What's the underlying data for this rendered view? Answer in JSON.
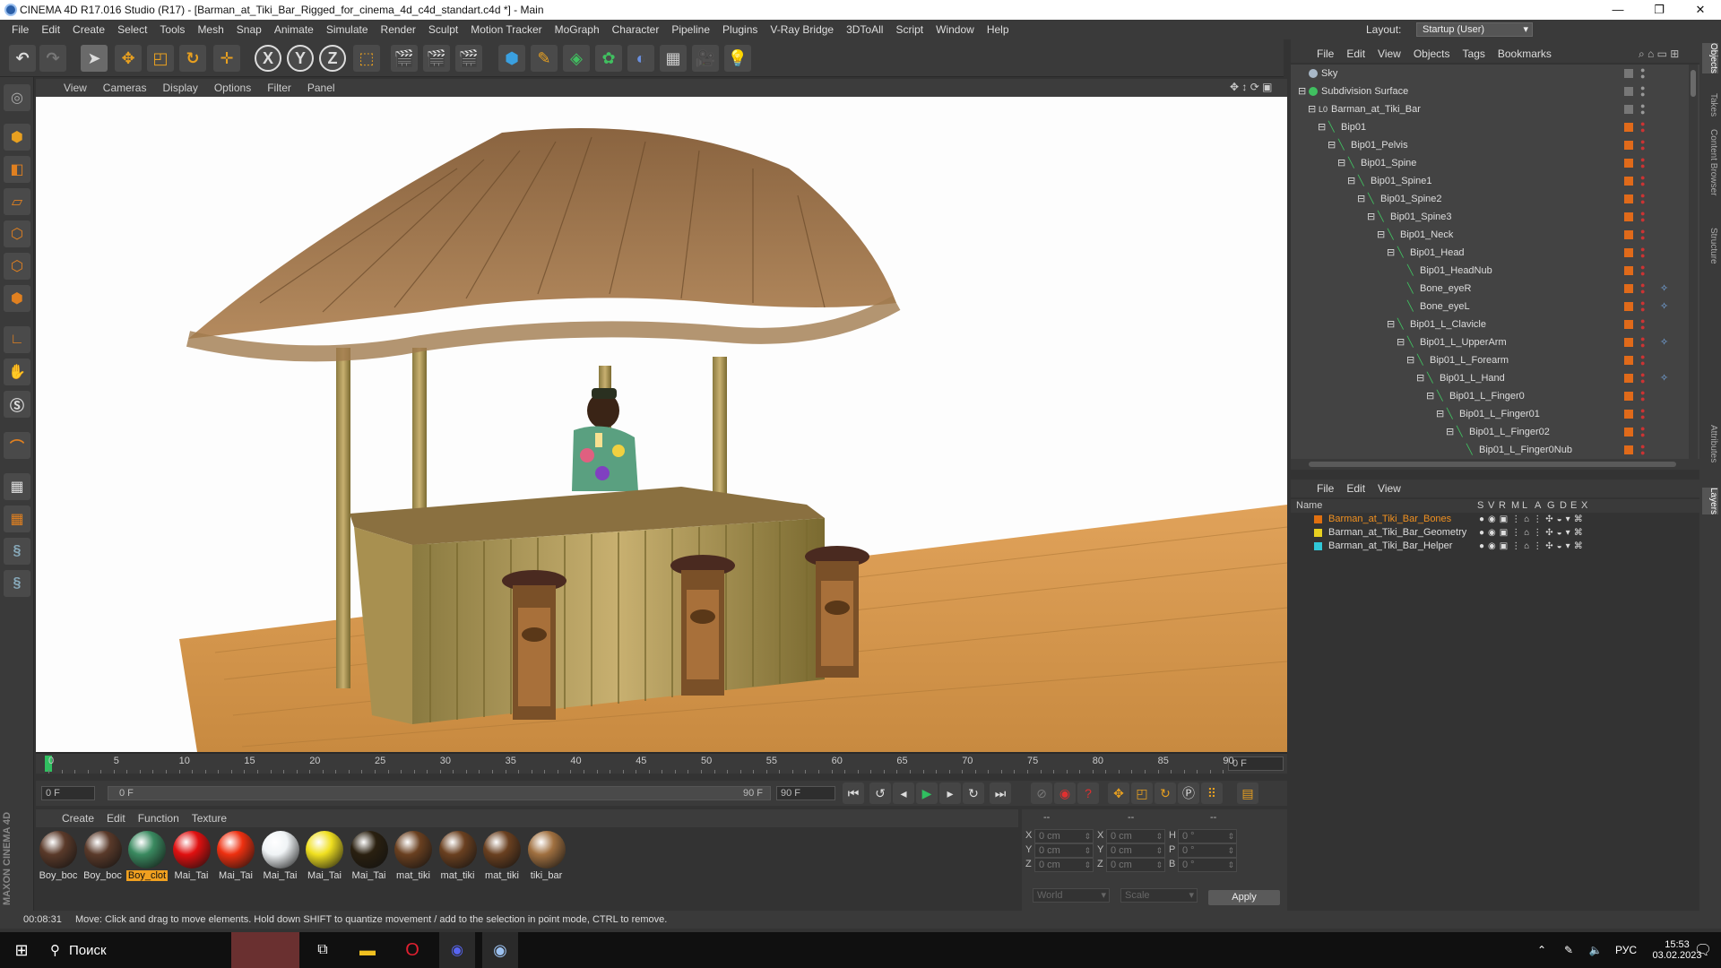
{
  "window": {
    "title": "CINEMA 4D R17.016 Studio (R17) - [Barman_at_Tiki_Bar_Rigged_for_cinema_4d_c4d_standart.c4d *] - Main",
    "minimize": "—",
    "restore": "❐",
    "close": "✕"
  },
  "menu": [
    "File",
    "Edit",
    "Create",
    "Select",
    "Tools",
    "Mesh",
    "Snap",
    "Animate",
    "Simulate",
    "Render",
    "Sculpt",
    "Motion Tracker",
    "MoGraph",
    "Character",
    "Pipeline",
    "Plugins",
    "V-Ray Bridge",
    "3DToAll",
    "Script",
    "Window",
    "Help"
  ],
  "layout": {
    "label": "Layout:",
    "value": "Startup (User)"
  },
  "toolbar": {
    "x": "X",
    "y": "Y",
    "z": "Z"
  },
  "viewport": {
    "menu": [
      "View",
      "Cameras",
      "Display",
      "Options",
      "Filter",
      "Panel"
    ]
  },
  "timeline": {
    "ticks": [
      "0",
      "5",
      "10",
      "15",
      "20",
      "25",
      "30",
      "35",
      "40",
      "45",
      "50",
      "55",
      "60",
      "65",
      "70",
      "75",
      "80",
      "85",
      "90"
    ],
    "current": "0 F"
  },
  "playback": {
    "start": "0 F",
    "range_start": "0 F",
    "range_end": "90 F",
    "end": "90 F"
  },
  "materials": {
    "menu": [
      "Create",
      "Edit",
      "Function",
      "Texture"
    ],
    "items": [
      {
        "name": "Boy_boc",
        "color": "#5a3a2a"
      },
      {
        "name": "Boy_boc",
        "color": "#5a3a2a"
      },
      {
        "name": "Boy_clot",
        "color": "#3a8a60",
        "selected": true
      },
      {
        "name": "Mai_Tai",
        "color": "#e01010"
      },
      {
        "name": "Mai_Tai",
        "color": "#ee3010"
      },
      {
        "name": "Mai_Tai",
        "color": "#f0f4f6"
      },
      {
        "name": "Mai_Tai",
        "color": "#f0e020"
      },
      {
        "name": "Mai_Tai",
        "color": "#2a2010"
      },
      {
        "name": "mat_tiki",
        "color": "#6a4020"
      },
      {
        "name": "mat_tiki",
        "color": "#6a4020"
      },
      {
        "name": "mat_tiki",
        "color": "#6a4020"
      },
      {
        "name": "tiki_bar",
        "color": "#a07040"
      }
    ]
  },
  "coordinates": {
    "headers": [
      "--",
      "--",
      "--"
    ],
    "rows": [
      {
        "a": "X",
        "av": "0 cm",
        "b": "X",
        "bv": "0 cm",
        "c": "H",
        "cv": "0 °"
      },
      {
        "a": "Y",
        "av": "0 cm",
        "b": "Y",
        "bv": "0 cm",
        "c": "P",
        "cv": "0 °"
      },
      {
        "a": "Z",
        "av": "0 cm",
        "b": "Z",
        "bv": "0 cm",
        "c": "B",
        "cv": "0 °"
      }
    ],
    "world": "World",
    "scale": "Scale",
    "apply": "Apply"
  },
  "objects": {
    "menu": [
      "File",
      "Edit",
      "View",
      "Objects",
      "Tags",
      "Bookmarks"
    ],
    "rows": [
      {
        "name": "Sky",
        "depth": 0,
        "icon": "sky"
      },
      {
        "name": "Subdivision Surface",
        "depth": 0,
        "icon": "subd"
      },
      {
        "name": "Barman_at_Tiki_Bar",
        "depth": 1,
        "icon": "null"
      },
      {
        "name": "Bip01",
        "depth": 2,
        "icon": "bone"
      },
      {
        "name": "Bip01_Pelvis",
        "depth": 3,
        "icon": "bone"
      },
      {
        "name": "Bip01_Spine",
        "depth": 4,
        "icon": "bone"
      },
      {
        "name": "Bip01_Spine1",
        "depth": 5,
        "icon": "bone"
      },
      {
        "name": "Bip01_Spine2",
        "depth": 6,
        "icon": "bone"
      },
      {
        "name": "Bip01_Spine3",
        "depth": 7,
        "icon": "bone"
      },
      {
        "name": "Bip01_Neck",
        "depth": 8,
        "icon": "bone"
      },
      {
        "name": "Bip01_Head",
        "depth": 9,
        "icon": "bone"
      },
      {
        "name": "Bip01_HeadNub",
        "depth": 10,
        "icon": "bone"
      },
      {
        "name": "Bone_eyeR",
        "depth": 10,
        "icon": "bone"
      },
      {
        "name": "Bone_eyeL",
        "depth": 10,
        "icon": "bone"
      },
      {
        "name": "Bip01_L_Clavicle",
        "depth": 9,
        "icon": "bone"
      },
      {
        "name": "Bip01_L_UpperArm",
        "depth": 10,
        "icon": "bone"
      },
      {
        "name": "Bip01_L_Forearm",
        "depth": 11,
        "icon": "bone"
      },
      {
        "name": "Bip01_L_Hand",
        "depth": 12,
        "icon": "bone"
      },
      {
        "name": "Bip01_L_Finger0",
        "depth": 13,
        "icon": "bone"
      },
      {
        "name": "Bip01_L_Finger01",
        "depth": 14,
        "icon": "bone"
      },
      {
        "name": "Bip01_L_Finger02",
        "depth": 15,
        "icon": "bone"
      },
      {
        "name": "Bip01_L_Finger0Nub",
        "depth": 16,
        "icon": "bone"
      }
    ]
  },
  "layers": {
    "menu": [
      "File",
      "Edit",
      "View"
    ],
    "columns": [
      "Name",
      "S",
      "V",
      "R",
      "M",
      "L",
      "A",
      "G",
      "D",
      "E",
      "X"
    ],
    "rows": [
      {
        "name": "Barman_at_Tiki_Bar_Bones",
        "color": "#e07010",
        "text_color": "#f09020"
      },
      {
        "name": "Barman_at_Tiki_Bar_Geometry",
        "color": "#e8d020",
        "text_color": "#dddddd"
      },
      {
        "name": "Barman_at_Tiki_Bar_Helper",
        "color": "#30c8d8",
        "text_color": "#dddddd"
      }
    ]
  },
  "side_tabs": [
    "Objects",
    "Takes",
    "Content Browser",
    "Structure",
    "Attributes",
    "Layers"
  ],
  "status": {
    "time": "00:08:31",
    "message": "Move: Click and drag to move elements. Hold down SHIFT to quantize movement / add to the selection in point mode, CTRL to remove."
  },
  "taskbar": {
    "search": "Поиск",
    "lang": "РУС",
    "time": "15:53",
    "date": "03.02.2023",
    "notif": "1"
  },
  "branding": "MAXON CINEMA 4D"
}
